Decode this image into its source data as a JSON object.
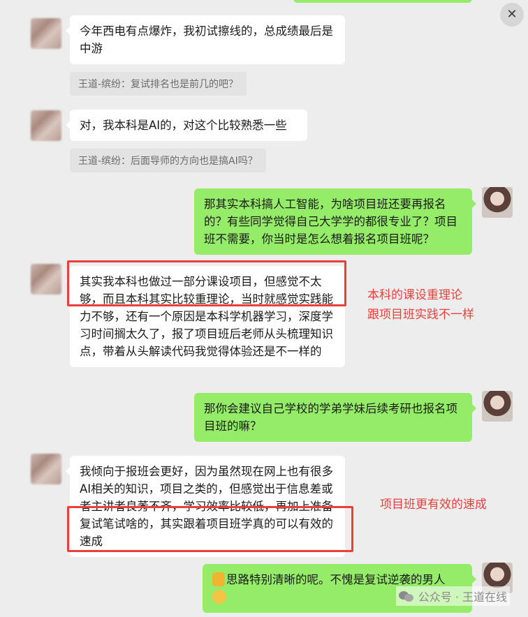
{
  "messages": {
    "m1": "今年西电有点爆炸，我初试擦线的，总成绩最后是中游",
    "q1": "王道-缤纷：复试排名也是前几的吧？",
    "m2": "对，我本科是AI的，对这个比较熟悉一些",
    "q2": "王道-缤纷：后面导师的方向也是搞AI吗？",
    "m3": "那其实本科搞人工智能，为啥项目班还要再报名的？有些同学觉得自己大学学的都很专业了？项目班不需要，你当时是怎么想着报名项目班呢？",
    "m4": "其实我本科也做过一部分课设项目，但感觉不太够，而且本科其实比较重理论，当时就感觉实践能力不够，还有一个原因是本科学机器学习，深度学习时间搁太久了，报了项目班后老师从头梳理知识点，带着从头解读代码我觉得体验还是不一样的",
    "m5": "那你会建议自己学校的学弟学妹后续考研也报名项目班的嘛？",
    "m6": "我倾向于报班会更好，因为虽然现在网上也有很多AI相关的知识，项目之类的，但感觉出于信息差或者主讲者良莠不齐，学习效率比较低，再加上准备复试笔试啥的，其实跟着项目班学真的可以有效的速成",
    "m7": "思路特别清晰的呢。不愧是复试逆袭的男人"
  },
  "annotations": {
    "a1_line1": "本科的课设重理论",
    "a1_line2": "跟项目班实践不一样",
    "a2": "项目班更有效的速成"
  },
  "watermark": {
    "text": "公众号 · 王道在线"
  },
  "controls": {
    "close_symbol": "✕"
  },
  "colors": {
    "background": "#ededed",
    "bubble_green": "#95ec69",
    "bubble_white": "#ffffff",
    "highlight_red": "#e8413d"
  }
}
